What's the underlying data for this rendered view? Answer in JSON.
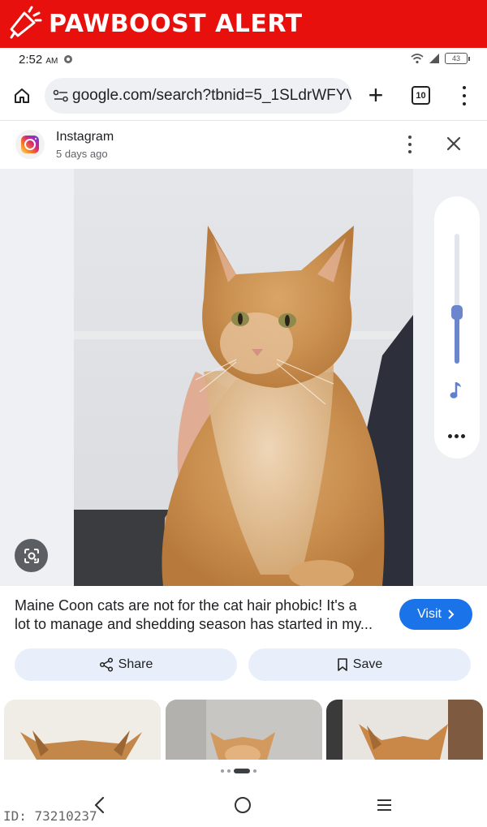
{
  "alert": {
    "title": "PAWBOOST ALERT"
  },
  "status_bar": {
    "time": "2:52",
    "ampm": "AM",
    "battery": "43"
  },
  "browser": {
    "url": "google.com/search?tbnid=5_1SLdrWFYV7",
    "tab_count": "10"
  },
  "source": {
    "name": "Instagram",
    "time": "5 days ago"
  },
  "caption": {
    "line1": "Maine Coon cats are not for the cat hair phobic! It's a",
    "line2": "lot to manage and shedding season has started in my..."
  },
  "actions": {
    "visit": "Visit",
    "share": "Share",
    "save": "Save"
  },
  "viewer": {
    "volume_level": 0.42
  },
  "footer": {
    "id_text": "ID: 73210237"
  },
  "colors": {
    "alert_red": "#e8100c",
    "visit_blue": "#1a73e8",
    "pill_bg": "#e8effb",
    "slider": "#6b86cc"
  }
}
